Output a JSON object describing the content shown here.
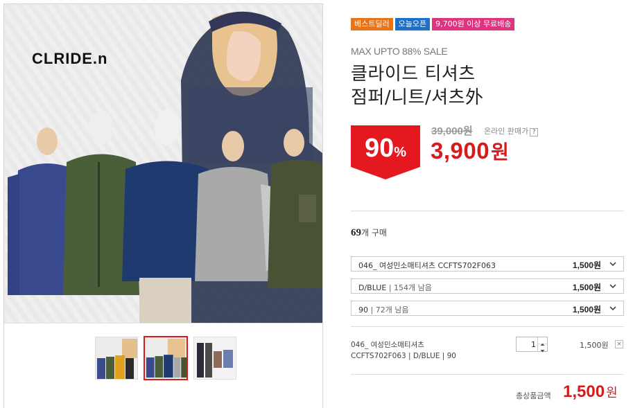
{
  "product_image": {
    "brand_logo": "CLRIDE.n"
  },
  "thumbnails": [
    {
      "name": "thumbnail-1",
      "active": false
    },
    {
      "name": "thumbnail-2",
      "active": true
    },
    {
      "name": "thumbnail-3",
      "active": false
    }
  ],
  "badges": [
    {
      "label": "베스트딜러",
      "color": "#e8741a"
    },
    {
      "label": "오늘오픈",
      "color": "#1e6fc8"
    },
    {
      "label": "9,700원 이상 무료배송",
      "color": "#e0337f"
    }
  ],
  "sale_text": "MAX UPTO 88% SALE",
  "title_line1": "클라이드 티셔츠",
  "title_line2": "점퍼/니트/셔츠外",
  "discount": {
    "number": "90",
    "percent": "%",
    "color": "#e4181e"
  },
  "original_price": "39,000원",
  "online_price_label": "온라인 판매가",
  "help_icon_text": "?",
  "sale_price": {
    "number": "3,900",
    "unit": "원"
  },
  "buy_count": {
    "number": "69",
    "suffix": "개 구매"
  },
  "options": [
    {
      "label": "046_ 여성민소매티셔츠 CCFTS702F063",
      "sub": "",
      "price": "1,500원"
    },
    {
      "label": "D/BLUE",
      "sub": "| 154개 남음",
      "price": "1,500원"
    },
    {
      "label": "90",
      "sub": "| 72개 남음",
      "price": "1,500원"
    }
  ],
  "selected_item": {
    "name": "046_ 여성민소매티셔츠",
    "code": "CCFTS702F063 | D/BLUE | 90",
    "quantity": "1",
    "price": "1,500원",
    "remove_icon": "×"
  },
  "total": {
    "label": "총상품금액",
    "number": "1,500",
    "unit": "원"
  },
  "colors": {
    "accent": "#d51c1c",
    "border": "#dddddd"
  }
}
